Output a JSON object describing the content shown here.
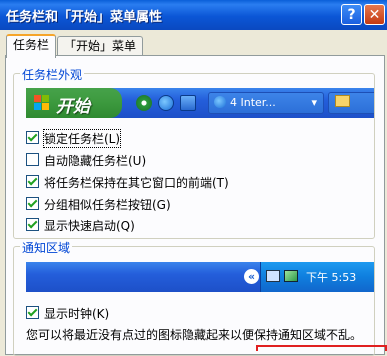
{
  "window": {
    "title": "任务栏和「开始」菜单属性",
    "help_label": "?",
    "close_label": "✕"
  },
  "tabs": [
    {
      "label": "任务栏"
    },
    {
      "label": "「开始」菜单"
    }
  ],
  "appearance": {
    "legend": "任务栏外观",
    "preview": {
      "start_label": "开始",
      "task_button_label": "4 Inter...",
      "colors": {
        "taskbar": "#245edb",
        "start": "#3d9a3f"
      }
    },
    "options": [
      {
        "label": "锁定任务栏(L)",
        "checked": true
      },
      {
        "label": "自动隐藏任务栏(U)",
        "checked": false
      },
      {
        "label": "将任务栏保持在其它窗口的前端(T)",
        "checked": true
      },
      {
        "label": "分组相似任务栏按钮(G)",
        "checked": true
      },
      {
        "label": "显示快速启动(Q)",
        "checked": true
      }
    ]
  },
  "notification": {
    "legend": "通知区域",
    "clock_text": "下午 5:53",
    "show_clock": {
      "label": "显示时钟(K)",
      "checked": true
    },
    "description": "您可以将最近没有点过的图标隐藏起来以便保持通知区域不乱。"
  }
}
